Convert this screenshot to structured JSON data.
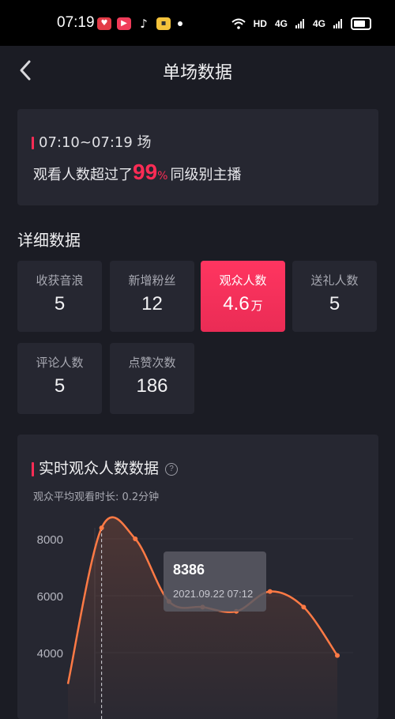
{
  "status_bar": {
    "time": "07:19",
    "network": "HD",
    "signal1": "4G",
    "signal2": "4G"
  },
  "header": {
    "title": "单场数据",
    "back_icon": "chevron-left-icon"
  },
  "summary": {
    "time_range": "07:10~07:19 场",
    "text_before": "观看人数超过了",
    "percent_value": "99",
    "percent_sign": "%",
    "text_after": "同级别主播"
  },
  "details": {
    "title": "详细数据",
    "metrics": [
      {
        "label": "收获音浪",
        "value": "5",
        "unit": ""
      },
      {
        "label": "新增粉丝",
        "value": "12",
        "unit": ""
      },
      {
        "label": "观众人数",
        "value": "4.6",
        "unit": "万"
      },
      {
        "label": "送礼人数",
        "value": "5",
        "unit": ""
      },
      {
        "label": "评论人数",
        "value": "5",
        "unit": ""
      },
      {
        "label": "点赞次数",
        "value": "186",
        "unit": ""
      }
    ]
  },
  "realtime": {
    "title": "实时观众人数数据",
    "subtitle": "观众平均观看时长: 0.2分钟",
    "tooltip": {
      "value": "8386",
      "date": "2021.09.22 07:12"
    }
  },
  "colors": {
    "accent": "#fe2c55",
    "line": "#ff7a45",
    "card": "#262731",
    "background": "#1b1c24"
  },
  "chart_data": {
    "type": "line",
    "yticks": [
      8000,
      6000,
      4000
    ],
    "y_visible_range": [
      2900,
      8400
    ],
    "series": [
      {
        "points": [
          {
            "x": 0,
            "y": 2900
          },
          {
            "x": 1,
            "y": 8386
          },
          {
            "x": 2,
            "y": 8000
          },
          {
            "x": 3,
            "y": 5800
          },
          {
            "x": 4,
            "y": 5600
          },
          {
            "x": 5,
            "y": 5450
          },
          {
            "x": 6,
            "y": 6150
          },
          {
            "x": 7,
            "y": 5600
          },
          {
            "x": 8,
            "y": 3900
          }
        ]
      }
    ],
    "highlight_index": 1
  }
}
